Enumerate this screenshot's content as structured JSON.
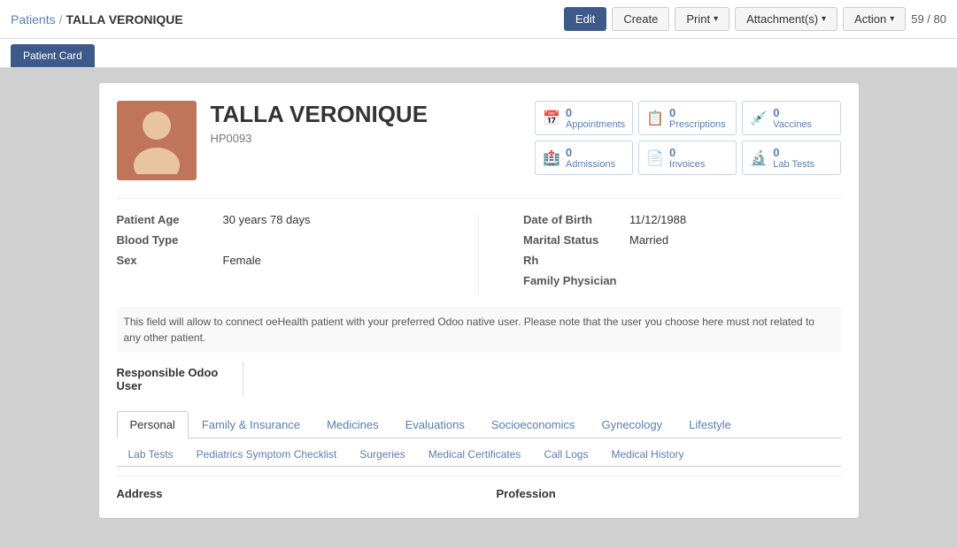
{
  "breadcrumb": {
    "link_label": "Patients",
    "separator": "/",
    "current": "TALLA VERONIQUE"
  },
  "toolbar": {
    "edit_label": "Edit",
    "create_label": "Create",
    "print_label": "Print",
    "attachments_label": "Attachment(s)",
    "action_label": "Action",
    "pagination": "59 / 80"
  },
  "patient_card_tab": "Patient Card",
  "patient": {
    "name": "TALLA VERONIQUE",
    "id": "HP0093",
    "avatar_alt": "Patient avatar"
  },
  "stats": [
    {
      "icon": "📅",
      "count": "0",
      "label": "Appointments"
    },
    {
      "icon": "📋",
      "count": "0",
      "label": "Prescriptions"
    },
    {
      "icon": "💉",
      "count": "0",
      "label": "Vaccines"
    },
    {
      "icon": "🏥",
      "count": "0",
      "label": "Admissions"
    },
    {
      "icon": "📄",
      "count": "0",
      "label": "Invoices"
    },
    {
      "icon": "🔬",
      "count": "0",
      "label": "Lab Tests"
    }
  ],
  "info_left": {
    "age_label": "Patient Age",
    "age_value": "30 years 78 days",
    "blood_label": "Blood Type",
    "blood_value": "",
    "sex_label": "Sex",
    "sex_value": "Female"
  },
  "info_right": {
    "dob_label": "Date of Birth",
    "dob_value": "11/12/1988",
    "marital_label": "Marital Status",
    "marital_value": "Married",
    "rh_label": "Rh",
    "rh_value": "",
    "physician_label": "Family Physician",
    "physician_value": ""
  },
  "notice": "This field will allow to connect oeHealth patient with your preferred Odoo native user. Please note that the user you choose here must not related to any other patient.",
  "responsible_label": "Responsible Odoo\nUser",
  "tabs_row1": [
    {
      "label": "Personal",
      "active": true
    },
    {
      "label": "Family & Insurance"
    },
    {
      "label": "Medicines"
    },
    {
      "label": "Evaluations"
    },
    {
      "label": "Socioeconomics"
    },
    {
      "label": "Gynecology"
    },
    {
      "label": "Lifestyle"
    }
  ],
  "tabs_row2": [
    {
      "label": "Lab Tests"
    },
    {
      "label": "Pediatrics Symptom Checklist"
    },
    {
      "label": "Surgeries"
    },
    {
      "label": "Medical Certificates"
    },
    {
      "label": "Call Logs"
    },
    {
      "label": "Medical History"
    }
  ],
  "bottom_fields": {
    "address_label": "Address",
    "profession_label": "Profession"
  }
}
